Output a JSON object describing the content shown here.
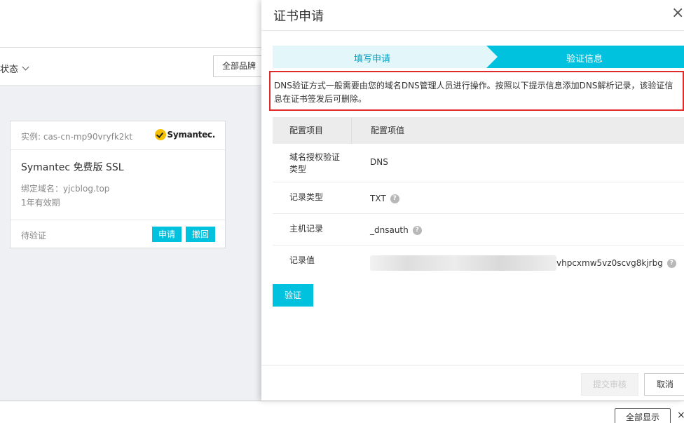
{
  "background": {
    "filter": {
      "status_label": "状态",
      "brand_label": "全部品牌"
    },
    "card": {
      "instance_id": "实例: cas-cn-mp90vryfk2kt",
      "logo_text": "Symantec.",
      "product_name": "Symantec 免费版 SSL",
      "bound_domain": "绑定域名：yjcblog.top",
      "validity": "1年有效期",
      "status": "待验证",
      "apply_label": "申请",
      "revoke_label": "撤回"
    },
    "bottom_bar": {
      "show_all_label": "全部显示",
      "close_icon": "×"
    }
  },
  "drawer": {
    "title": "证书申请",
    "close_icon": "×",
    "steps": [
      {
        "label": "填写申请",
        "active": false
      },
      {
        "label": "验证信息",
        "active": true
      }
    ],
    "notice": "DNS验证方式一般需要由您的域名DNS管理人员进行操作。按照以下提示信息添加DNS解析记录，该验证信息在证书签发后可删除。",
    "table": {
      "headers": [
        "配置项目",
        "配置项值"
      ],
      "rows": [
        {
          "key": "域名授权验证类型",
          "value": "DNS",
          "help": false
        },
        {
          "key": "记录类型",
          "value": "TXT",
          "help": true
        },
        {
          "key": "主机记录",
          "value": "_dnsauth",
          "help": true
        },
        {
          "key": "记录值",
          "value": "vhpcxmw5vz0scvg8kjrbg",
          "help": true,
          "redacted_prefix": true
        }
      ]
    },
    "verify_label": "验证",
    "footer": {
      "submit_label": "提交审核",
      "cancel_label": "取消"
    }
  },
  "colors": {
    "accent": "#00c1de",
    "highlight_border": "#e32a2a",
    "step_inactive_bg": "#e3f6fa"
  }
}
